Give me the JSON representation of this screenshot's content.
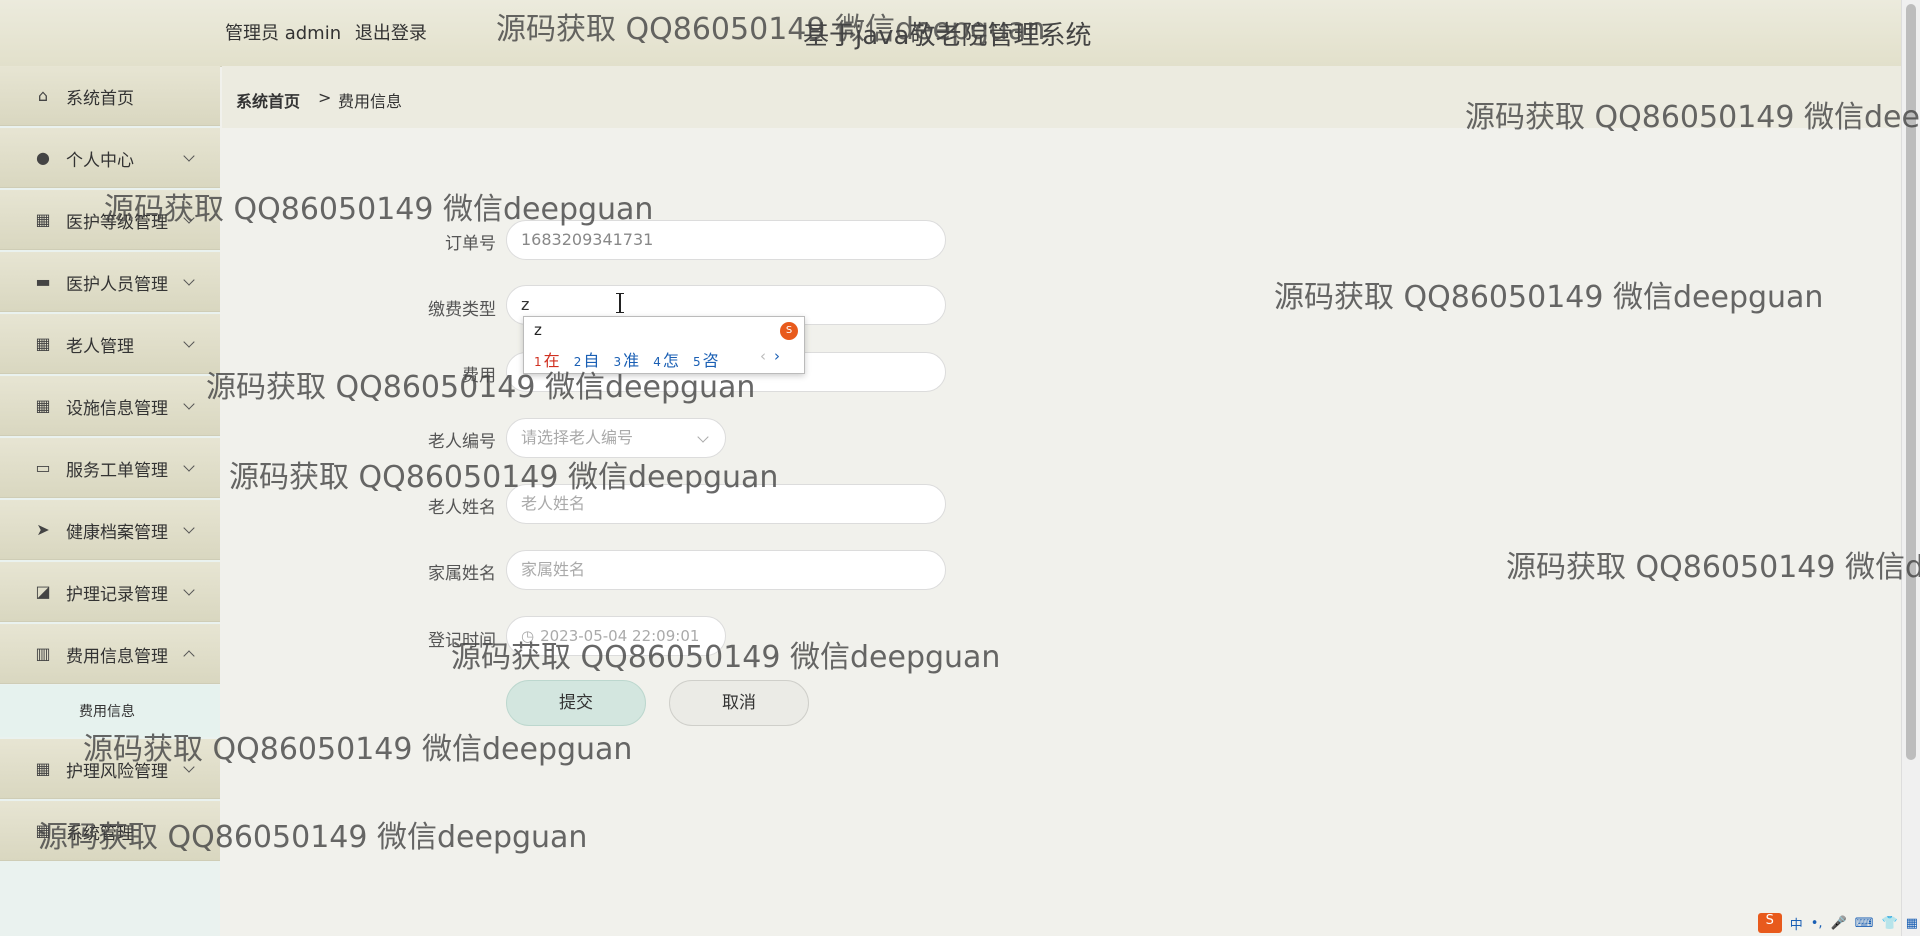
{
  "header": {
    "user": "管理员 admin",
    "logout": "退出登录",
    "title": "基于java敬老院管理系统"
  },
  "sidebar": {
    "items": [
      {
        "label": "系统首页",
        "icon": "home-icon",
        "glyph": "⌂"
      },
      {
        "label": "个人中心",
        "icon": "user-icon",
        "glyph": "●"
      },
      {
        "label": "医护等级管理",
        "icon": "grid-icon",
        "glyph": "▦"
      },
      {
        "label": "医护人员管理",
        "icon": "chat-icon",
        "glyph": "▬"
      },
      {
        "label": "老人管理",
        "icon": "grid-icon",
        "glyph": "▦"
      },
      {
        "label": "设施信息管理",
        "icon": "grid-icon",
        "glyph": "▦"
      },
      {
        "label": "服务工单管理",
        "icon": "monitor-icon",
        "glyph": "▭"
      },
      {
        "label": "健康档案管理",
        "icon": "send-icon",
        "glyph": "➤"
      },
      {
        "label": "护理记录管理",
        "icon": "chart-icon",
        "glyph": "◪"
      },
      {
        "label": "费用信息管理",
        "icon": "bar-icon",
        "glyph": "▥"
      },
      {
        "label": "护理风险管理",
        "icon": "grid-icon",
        "glyph": "▦"
      },
      {
        "label": "系统管理",
        "icon": "grid-icon",
        "glyph": "▦"
      }
    ],
    "submenu_item": "费用信息"
  },
  "breadcrumb": {
    "home": "系统首页",
    "separator": ">",
    "current": "费用信息"
  },
  "form": {
    "order_no": {
      "label": "订单号",
      "value": "1683209341731"
    },
    "fee_type": {
      "label": "缴费类型",
      "value": "z"
    },
    "fee": {
      "label": "费用",
      "value": ""
    },
    "elder_no": {
      "label": "老人编号",
      "placeholder": "请选择老人编号"
    },
    "elder_name": {
      "label": "老人姓名",
      "placeholder": "老人姓名"
    },
    "family_name": {
      "label": "家属姓名",
      "placeholder": "家属姓名"
    },
    "register_time": {
      "label": "登记时间",
      "value": "2023-05-04 22:09:01"
    },
    "submit": "提交",
    "cancel": "取消"
  },
  "ime": {
    "composition": "z",
    "candidates": [
      {
        "num": "1",
        "text": "在"
      },
      {
        "num": "2",
        "text": "自"
      },
      {
        "num": "3",
        "text": "准"
      },
      {
        "num": "4",
        "text": "怎"
      },
      {
        "num": "5",
        "text": "咨"
      }
    ],
    "prev": "‹",
    "next": "›"
  },
  "tray": {
    "logo": "S",
    "lang": "中",
    "items": [
      "•,",
      "🎤",
      "⌨",
      "👕",
      "▦"
    ]
  },
  "watermark": "源码获取 QQ86050149 微信deepguan"
}
